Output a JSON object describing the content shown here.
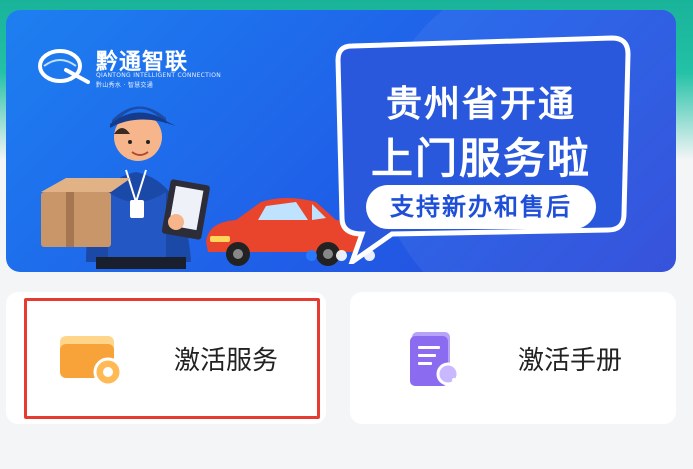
{
  "banner": {
    "logo_text": "黔通智联",
    "logo_sub_en": "QIANTONG INTELLIGENT CONNECTION",
    "logo_sub_cn": "黔山秀水 · 智慧交通",
    "headline_line1": "贵州省开通",
    "headline_line2": "上门服务啦",
    "pill_text": "支持新办和售后",
    "carousel_dots": 3,
    "carousel_active_index": 0
  },
  "cards": [
    {
      "label": "激活服务",
      "icon": "wallet-card-icon",
      "highlighted": true
    },
    {
      "label": "激活手册",
      "icon": "document-search-icon",
      "highlighted": false
    }
  ],
  "colors": {
    "header_teal": "#19b39a",
    "banner_blue": "#1f66ec",
    "highlight_red": "#e53b30",
    "icon_orange": "#f7a33a",
    "icon_purple": "#8b6cf1"
  }
}
